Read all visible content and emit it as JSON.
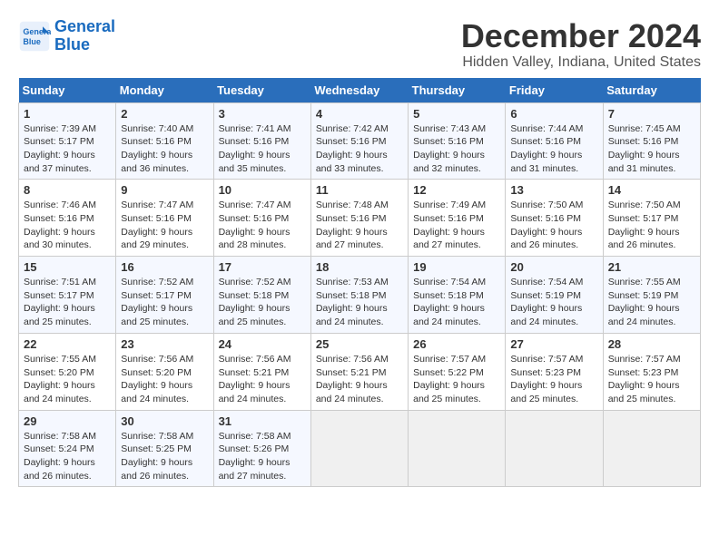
{
  "logo": {
    "line1": "General",
    "line2": "Blue"
  },
  "title": "December 2024",
  "subtitle": "Hidden Valley, Indiana, United States",
  "days_of_week": [
    "Sunday",
    "Monday",
    "Tuesday",
    "Wednesday",
    "Thursday",
    "Friday",
    "Saturday"
  ],
  "weeks": [
    [
      {
        "day": "1",
        "sunrise": "Sunrise: 7:39 AM",
        "sunset": "Sunset: 5:17 PM",
        "daylight": "Daylight: 9 hours and 37 minutes."
      },
      {
        "day": "2",
        "sunrise": "Sunrise: 7:40 AM",
        "sunset": "Sunset: 5:16 PM",
        "daylight": "Daylight: 9 hours and 36 minutes."
      },
      {
        "day": "3",
        "sunrise": "Sunrise: 7:41 AM",
        "sunset": "Sunset: 5:16 PM",
        "daylight": "Daylight: 9 hours and 35 minutes."
      },
      {
        "day": "4",
        "sunrise": "Sunrise: 7:42 AM",
        "sunset": "Sunset: 5:16 PM",
        "daylight": "Daylight: 9 hours and 33 minutes."
      },
      {
        "day": "5",
        "sunrise": "Sunrise: 7:43 AM",
        "sunset": "Sunset: 5:16 PM",
        "daylight": "Daylight: 9 hours and 32 minutes."
      },
      {
        "day": "6",
        "sunrise": "Sunrise: 7:44 AM",
        "sunset": "Sunset: 5:16 PM",
        "daylight": "Daylight: 9 hours and 31 minutes."
      },
      {
        "day": "7",
        "sunrise": "Sunrise: 7:45 AM",
        "sunset": "Sunset: 5:16 PM",
        "daylight": "Daylight: 9 hours and 31 minutes."
      }
    ],
    [
      {
        "day": "8",
        "sunrise": "Sunrise: 7:46 AM",
        "sunset": "Sunset: 5:16 PM",
        "daylight": "Daylight: 9 hours and 30 minutes."
      },
      {
        "day": "9",
        "sunrise": "Sunrise: 7:47 AM",
        "sunset": "Sunset: 5:16 PM",
        "daylight": "Daylight: 9 hours and 29 minutes."
      },
      {
        "day": "10",
        "sunrise": "Sunrise: 7:47 AM",
        "sunset": "Sunset: 5:16 PM",
        "daylight": "Daylight: 9 hours and 28 minutes."
      },
      {
        "day": "11",
        "sunrise": "Sunrise: 7:48 AM",
        "sunset": "Sunset: 5:16 PM",
        "daylight": "Daylight: 9 hours and 27 minutes."
      },
      {
        "day": "12",
        "sunrise": "Sunrise: 7:49 AM",
        "sunset": "Sunset: 5:16 PM",
        "daylight": "Daylight: 9 hours and 27 minutes."
      },
      {
        "day": "13",
        "sunrise": "Sunrise: 7:50 AM",
        "sunset": "Sunset: 5:16 PM",
        "daylight": "Daylight: 9 hours and 26 minutes."
      },
      {
        "day": "14",
        "sunrise": "Sunrise: 7:50 AM",
        "sunset": "Sunset: 5:17 PM",
        "daylight": "Daylight: 9 hours and 26 minutes."
      }
    ],
    [
      {
        "day": "15",
        "sunrise": "Sunrise: 7:51 AM",
        "sunset": "Sunset: 5:17 PM",
        "daylight": "Daylight: 9 hours and 25 minutes."
      },
      {
        "day": "16",
        "sunrise": "Sunrise: 7:52 AM",
        "sunset": "Sunset: 5:17 PM",
        "daylight": "Daylight: 9 hours and 25 minutes."
      },
      {
        "day": "17",
        "sunrise": "Sunrise: 7:52 AM",
        "sunset": "Sunset: 5:18 PM",
        "daylight": "Daylight: 9 hours and 25 minutes."
      },
      {
        "day": "18",
        "sunrise": "Sunrise: 7:53 AM",
        "sunset": "Sunset: 5:18 PM",
        "daylight": "Daylight: 9 hours and 24 minutes."
      },
      {
        "day": "19",
        "sunrise": "Sunrise: 7:54 AM",
        "sunset": "Sunset: 5:18 PM",
        "daylight": "Daylight: 9 hours and 24 minutes."
      },
      {
        "day": "20",
        "sunrise": "Sunrise: 7:54 AM",
        "sunset": "Sunset: 5:19 PM",
        "daylight": "Daylight: 9 hours and 24 minutes."
      },
      {
        "day": "21",
        "sunrise": "Sunrise: 7:55 AM",
        "sunset": "Sunset: 5:19 PM",
        "daylight": "Daylight: 9 hours and 24 minutes."
      }
    ],
    [
      {
        "day": "22",
        "sunrise": "Sunrise: 7:55 AM",
        "sunset": "Sunset: 5:20 PM",
        "daylight": "Daylight: 9 hours and 24 minutes."
      },
      {
        "day": "23",
        "sunrise": "Sunrise: 7:56 AM",
        "sunset": "Sunset: 5:20 PM",
        "daylight": "Daylight: 9 hours and 24 minutes."
      },
      {
        "day": "24",
        "sunrise": "Sunrise: 7:56 AM",
        "sunset": "Sunset: 5:21 PM",
        "daylight": "Daylight: 9 hours and 24 minutes."
      },
      {
        "day": "25",
        "sunrise": "Sunrise: 7:56 AM",
        "sunset": "Sunset: 5:21 PM",
        "daylight": "Daylight: 9 hours and 24 minutes."
      },
      {
        "day": "26",
        "sunrise": "Sunrise: 7:57 AM",
        "sunset": "Sunset: 5:22 PM",
        "daylight": "Daylight: 9 hours and 25 minutes."
      },
      {
        "day": "27",
        "sunrise": "Sunrise: 7:57 AM",
        "sunset": "Sunset: 5:23 PM",
        "daylight": "Daylight: 9 hours and 25 minutes."
      },
      {
        "day": "28",
        "sunrise": "Sunrise: 7:57 AM",
        "sunset": "Sunset: 5:23 PM",
        "daylight": "Daylight: 9 hours and 25 minutes."
      }
    ],
    [
      {
        "day": "29",
        "sunrise": "Sunrise: 7:58 AM",
        "sunset": "Sunset: 5:24 PM",
        "daylight": "Daylight: 9 hours and 26 minutes."
      },
      {
        "day": "30",
        "sunrise": "Sunrise: 7:58 AM",
        "sunset": "Sunset: 5:25 PM",
        "daylight": "Daylight: 9 hours and 26 minutes."
      },
      {
        "day": "31",
        "sunrise": "Sunrise: 7:58 AM",
        "sunset": "Sunset: 5:26 PM",
        "daylight": "Daylight: 9 hours and 27 minutes."
      },
      null,
      null,
      null,
      null
    ]
  ]
}
